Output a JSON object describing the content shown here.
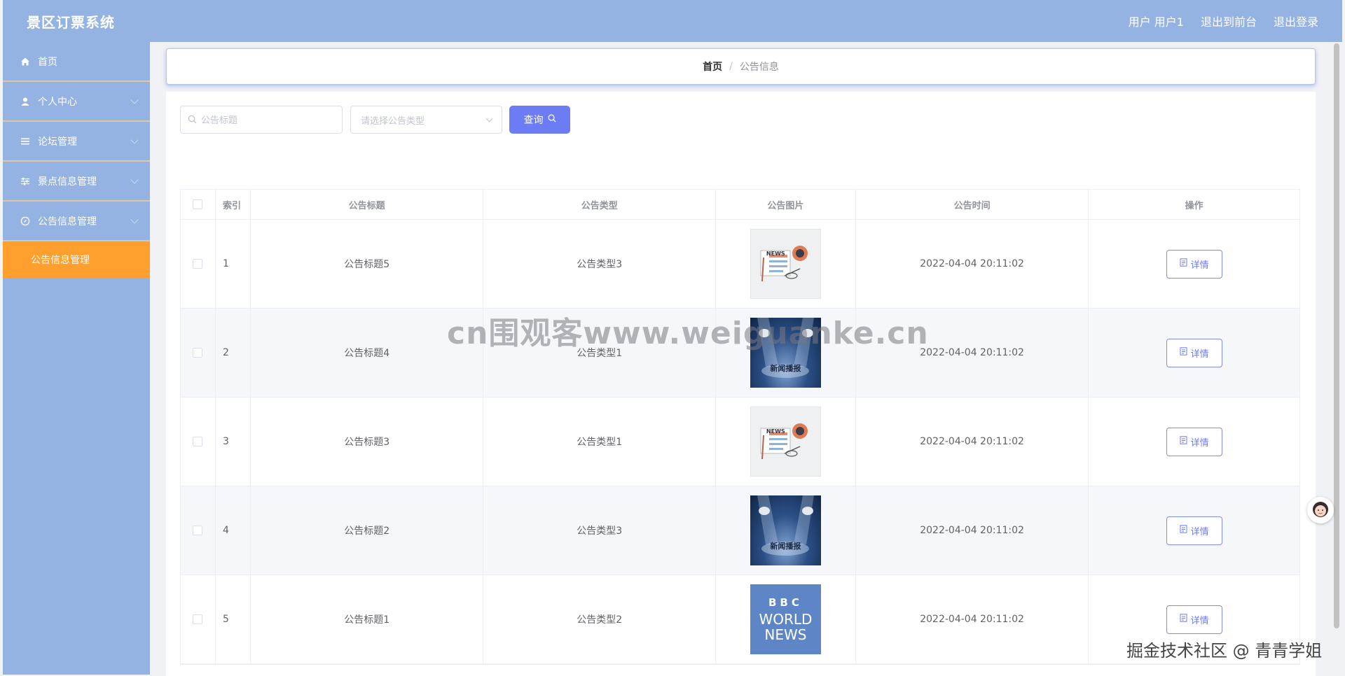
{
  "header": {
    "brand": "景区订票系统",
    "user_label": "用户 用户1",
    "back_to_front": "退出到前台",
    "logout": "退出登录"
  },
  "sidebar": {
    "items": [
      {
        "label": "首页",
        "icon": "home-icon"
      },
      {
        "label": "个人中心",
        "icon": "user-icon"
      },
      {
        "label": "论坛管理",
        "icon": "list-icon"
      },
      {
        "label": "景点信息管理",
        "icon": "sliders-icon"
      },
      {
        "label": "公告信息管理",
        "icon": "compass-icon"
      }
    ],
    "active_sub": "公告信息管理"
  },
  "breadcrumb": {
    "home": "首页",
    "sep": "/",
    "current": "公告信息"
  },
  "search": {
    "title_placeholder": "公告标题",
    "type_placeholder": "请选择公告类型",
    "query_label": "查询"
  },
  "table": {
    "headers": {
      "index": "索引",
      "title": "公告标题",
      "type": "公告类型",
      "image": "公告图片",
      "time": "公告时间",
      "op": "操作"
    },
    "detail_label": "详情",
    "rows": [
      {
        "index": "1",
        "title": "公告标题5",
        "type": "公告类型3",
        "image": "news-illustration",
        "time": "2022-04-04 20:11:02"
      },
      {
        "index": "2",
        "title": "公告标题4",
        "type": "公告类型1",
        "image": "news-stage",
        "stage_text": "新闻播报",
        "time": "2022-04-04 20:11:02"
      },
      {
        "index": "3",
        "title": "公告标题3",
        "type": "公告类型1",
        "image": "news-illustration",
        "time": "2022-04-04 20:11:02"
      },
      {
        "index": "4",
        "title": "公告标题2",
        "type": "公告类型3",
        "image": "news-stage",
        "stage_text": "新闻播报",
        "time": "2022-04-04 20:11:02"
      },
      {
        "index": "5",
        "title": "公告标题1",
        "type": "公告类型2",
        "image": "bbc-world-news",
        "bbc": "BBC",
        "bbc_line1": "WORLD",
        "bbc_line2": "NEWS",
        "time": "2022-04-04 20:11:02"
      }
    ]
  },
  "news_thumb_label": "NEWS",
  "watermark": "cn围观客www.weiguanke.cn",
  "footer_watermark": "掘金技术社区 @ 青青学姐",
  "colors": {
    "header_bg": "#94b3e2",
    "active_menu": "#ff9f2e",
    "primary": "#6b7cf5"
  }
}
